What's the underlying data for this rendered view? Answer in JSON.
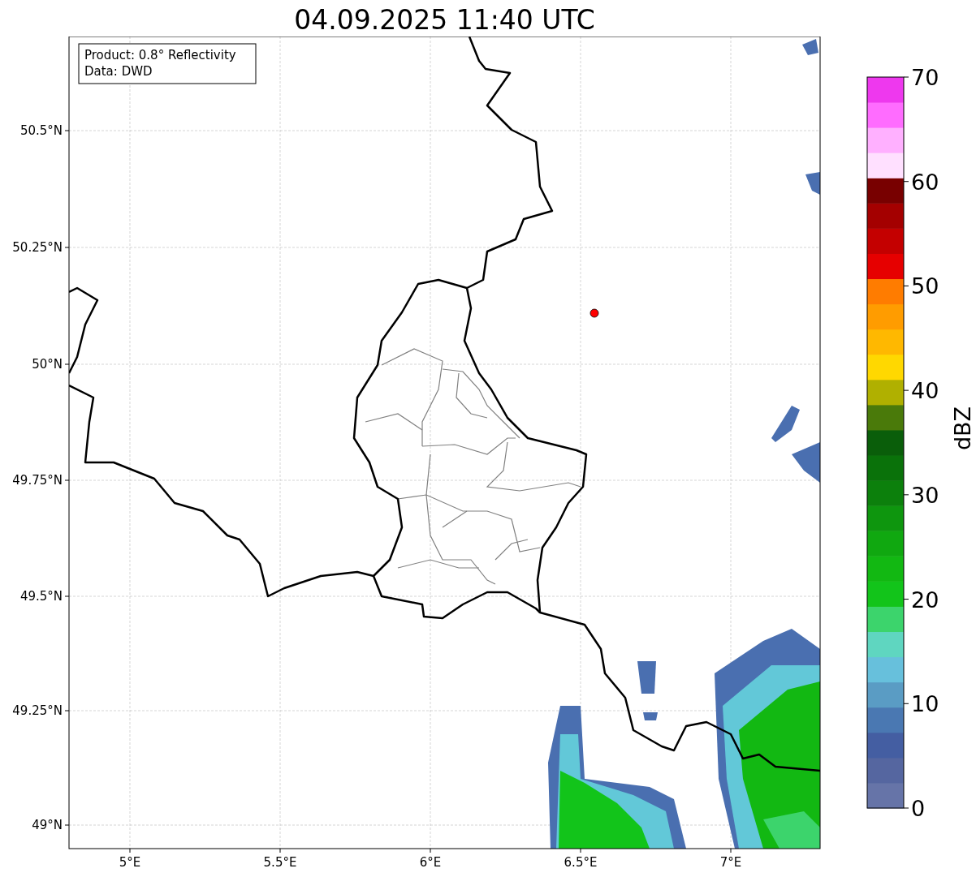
{
  "title": "04.09.2025 11:40 UTC",
  "info_box": [
    "Product: 0.8° Reflectivity",
    "Data: DWD"
  ],
  "lat_ticks": [
    "50.5°N",
    "50.25°N",
    "50°N",
    "49.75°N",
    "49.5°N",
    "49.25°N",
    "49°N"
  ],
  "lon_ticks": [
    "5°E",
    "5.5°E",
    "6°E",
    "6.5°E",
    "7°E"
  ],
  "colorbar": {
    "label": "dBZ",
    "ticks": [
      "70",
      "60",
      "50",
      "40",
      "30",
      "20",
      "10",
      "0"
    ],
    "bins": [
      {
        "color": "#6674a8"
      },
      {
        "color": "#5566a0"
      },
      {
        "color": "#445ea2"
      },
      {
        "color": "#4a78b2"
      },
      {
        "color": "#5a9cc4"
      },
      {
        "color": "#67c0dc"
      },
      {
        "color": "#5fd6c0"
      },
      {
        "color": "#3cd46c"
      },
      {
        "color": "#12c41a"
      },
      {
        "color": "#12b812"
      },
      {
        "color": "#10a810"
      },
      {
        "color": "#0e960e"
      },
      {
        "color": "#0c800c"
      },
      {
        "color": "#0a720a"
      },
      {
        "color": "#0a5e0a"
      },
      {
        "color": "#4a7a0a"
      },
      {
        "color": "#b0b000"
      },
      {
        "color": "#ffd800"
      },
      {
        "color": "#ffb800"
      },
      {
        "color": "#ff9c00"
      },
      {
        "color": "#ff7c00"
      },
      {
        "color": "#e60000"
      },
      {
        "color": "#c40000"
      },
      {
        "color": "#a40000"
      },
      {
        "color": "#780000"
      },
      {
        "color": "#ffe0ff"
      },
      {
        "color": "#ffb0ff"
      },
      {
        "color": "#ff6cff"
      },
      {
        "color": "#ee38ee"
      }
    ]
  }
}
